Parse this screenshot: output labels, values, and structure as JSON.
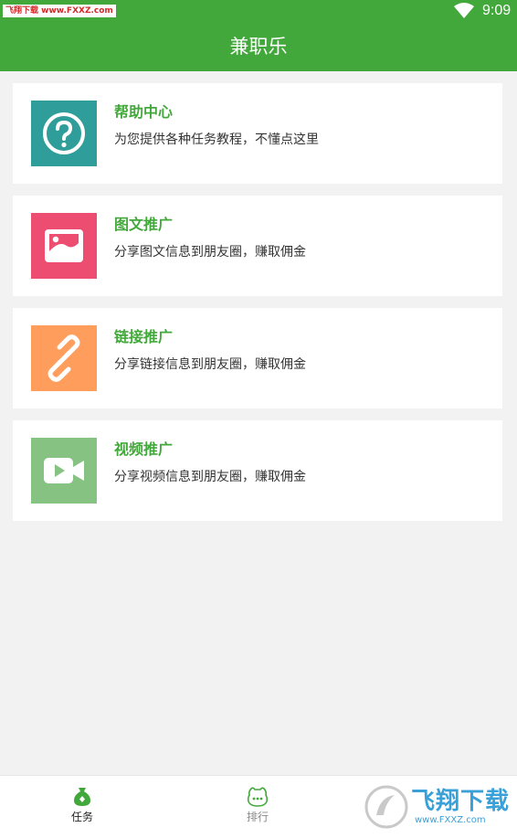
{
  "status_bar": {
    "watermark": "飞翔下载 www.FXXZ.com",
    "time": "9:09"
  },
  "app_bar": {
    "title": "兼职乐"
  },
  "cards": [
    {
      "title": "帮助中心",
      "desc": "为您提供各种任务教程，不懂点这里",
      "icon": "help-icon",
      "color": "#2f9e9a"
    },
    {
      "title": "图文推广",
      "desc": "分享图文信息到朋友圈，赚取佣金",
      "icon": "image-icon",
      "color": "#ee4d72"
    },
    {
      "title": "链接推广",
      "desc": "分享链接信息到朋友圈，赚取佣金",
      "icon": "link-icon",
      "color": "#ff9d5c"
    },
    {
      "title": "视频推广",
      "desc": "分享视频信息到朋友圈，赚取佣金",
      "icon": "video-icon",
      "color": "#86c282"
    }
  ],
  "bottom_nav": {
    "items": [
      {
        "label": "任务",
        "icon": "money-bag-icon",
        "active": true
      },
      {
        "label": "排行",
        "icon": "rank-icon",
        "active": false
      }
    ]
  },
  "watermark_logo": {
    "text": "飞翔下载",
    "url": "www.FXXZ.com"
  },
  "colors": {
    "brand_green": "#43a83b",
    "background": "#f2f2f2"
  }
}
